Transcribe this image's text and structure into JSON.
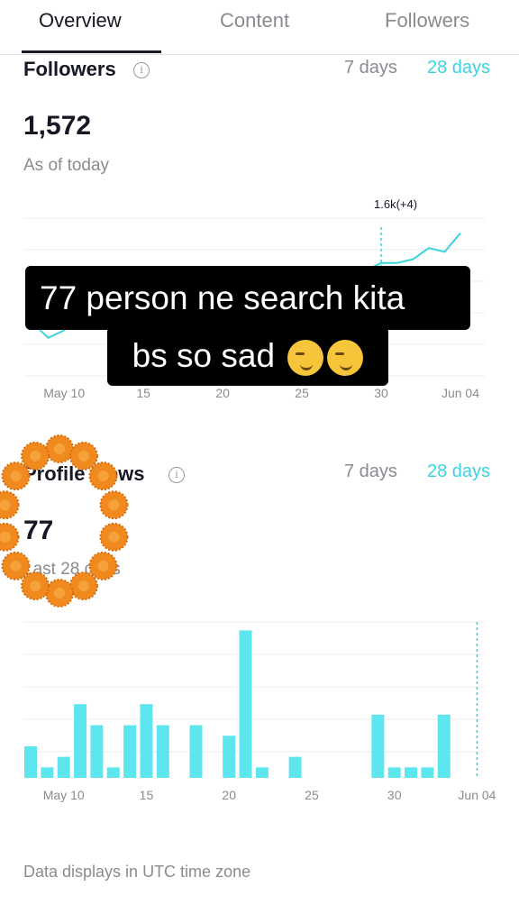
{
  "tabs": [
    {
      "label": "Overview",
      "active": true
    },
    {
      "label": "Content",
      "active": false
    },
    {
      "label": "Followers",
      "active": false
    }
  ],
  "followers": {
    "title": "Followers",
    "range_7": "7 days",
    "range_28": "28 days",
    "total": "1,572",
    "subtitle": "As of today",
    "tooltip": "1.6k(+4)"
  },
  "profile_views": {
    "title": "Profile views",
    "range_7": "7 days",
    "range_28": "28 days",
    "total": "77",
    "subtitle": "Last 28 days"
  },
  "x_ticks": [
    "May 10",
    "15",
    "20",
    "25",
    "30",
    "Jun 04"
  ],
  "caption": {
    "line1": "77 person ne search kita",
    "line2": "bs so sad"
  },
  "footer": "Data displays in UTC time zone",
  "colors": {
    "accent": "#3ad4dc",
    "bar": "#5ee6ee",
    "caption_bg": "#000000",
    "marigold": "#f08a1e"
  },
  "chart_data": [
    {
      "type": "line",
      "title": "Followers",
      "x": [
        "May 08",
        "May 09",
        "May 10",
        "May 11",
        "May 12",
        "May 13",
        "May 14",
        "May 15",
        "May 16",
        "May 17",
        "May 18",
        "May 19",
        "May 20",
        "May 21",
        "May 22",
        "May 23",
        "May 24",
        "May 25",
        "May 26",
        "May 27",
        "May 28",
        "May 29",
        "May 30",
        "May 31",
        "Jun 01",
        "Jun 02",
        "Jun 03",
        "Jun 04"
      ],
      "values": [
        1552,
        1548,
        1550,
        1555,
        1558,
        1556,
        1557,
        1558,
        1559,
        1560,
        1560,
        1561,
        1561,
        1562,
        1562,
        1563,
        1563,
        1564,
        1564,
        1565,
        1565,
        1566,
        1568,
        1568,
        1569,
        1572,
        1571,
        1576
      ],
      "highlight": {
        "x": "May 30",
        "label": "1.6k(+4)"
      },
      "grid": true
    },
    {
      "type": "bar",
      "title": "Profile views",
      "x": [
        "May 08",
        "May 09",
        "May 10",
        "May 11",
        "May 12",
        "May 13",
        "May 14",
        "May 15",
        "May 16",
        "May 17",
        "May 18",
        "May 19",
        "May 20",
        "May 21",
        "May 22",
        "May 23",
        "May 24",
        "May 25",
        "May 26",
        "May 27",
        "May 28",
        "May 29",
        "May 30",
        "May 31",
        "Jun 01",
        "Jun 02",
        "Jun 03",
        "Jun 04"
      ],
      "values": [
        3,
        1,
        2,
        7,
        5,
        1,
        5,
        7,
        5,
        0,
        5,
        0,
        4,
        14,
        1,
        0,
        2,
        0,
        0,
        0,
        0,
        6,
        1,
        1,
        1,
        6,
        0,
        0
      ],
      "grid": true
    }
  ]
}
